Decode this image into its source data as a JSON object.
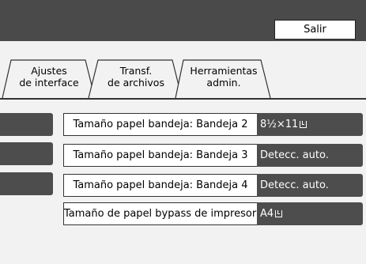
{
  "header": {
    "exit_label": "Salir"
  },
  "tabs": [
    {
      "line1": "Ajustes",
      "line2": "de interface"
    },
    {
      "line1": "Transf.",
      "line2": "de archivos"
    },
    {
      "line1": "Herramientas",
      "line2": "admin."
    }
  ],
  "settings": [
    {
      "label": "Tamaño papel bandeja: Bandeja 2",
      "value": "8½×11",
      "icon": "paper-orientation-icon"
    },
    {
      "label": "Tamaño papel bandeja: Bandeja 3",
      "value": "Detecc. auto."
    },
    {
      "label": "Tamaño papel bandeja: Bandeja 4",
      "value": "Detecc. auto."
    },
    {
      "label": "Tamaño de papel bypass de impresora",
      "value": "A4",
      "icon": "paper-orientation-icon"
    }
  ],
  "colors": {
    "header_bg": "#4a4a4a",
    "value_bg": "#4d4d4d",
    "page_bg": "#f2f2f2"
  }
}
